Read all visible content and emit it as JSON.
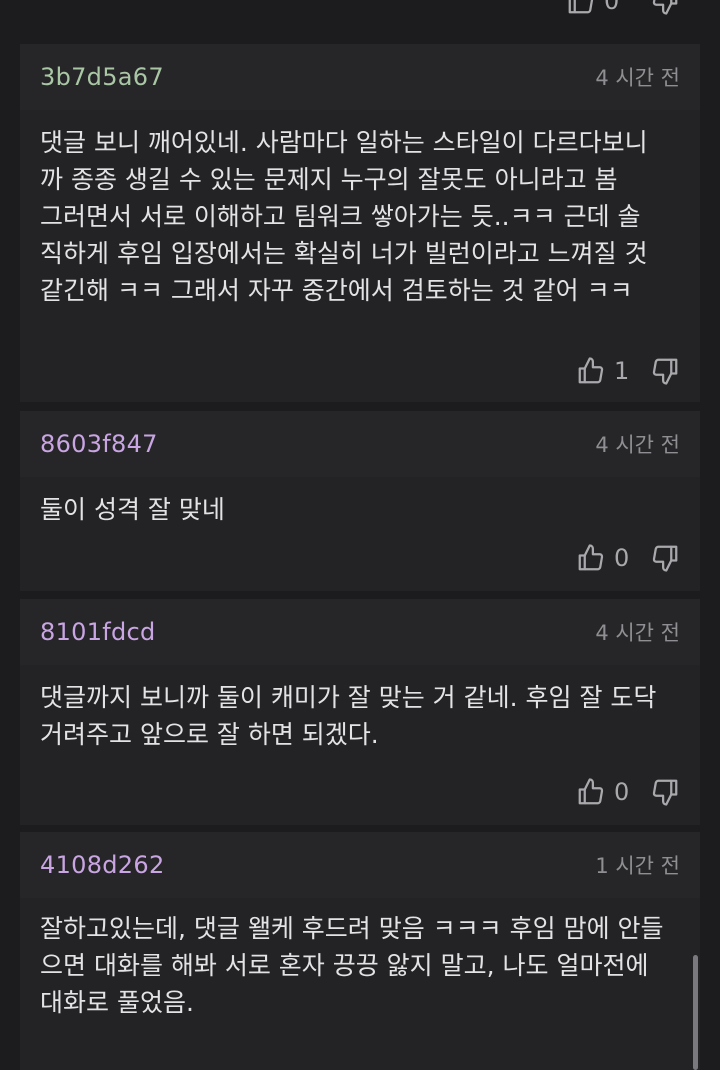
{
  "colors": {
    "background": "#1c1c1e",
    "card": "#232325",
    "text": "#e3e3e5",
    "muted": "#8f8f93"
  },
  "top": {
    "like_count": "0"
  },
  "comments": [
    {
      "author": "3b7d5a67",
      "author_color": "#a9c6a5",
      "time": "4 시간 전",
      "text": "댓글 보니 깨어있네. 사람마다 일하는 스타일이 다르다보니\n까 종종 생길 수 있는 문제지 누구의 잘못도 아니라고 봄\n그러면서 서로 이해하고 팀워크 쌓아가는 듯..ㅋㅋ 근데 솔\n직하게 후임 입장에서는 확실히 너가 빌런이라고 느껴질 것\n같긴해 ㅋㅋ 그래서 자꾸 중간에서 검토하는 것 같어 ㅋㅋ",
      "likes": "1"
    },
    {
      "author": "8603f847",
      "author_color": "#c9a5e3",
      "time": "4 시간 전",
      "text": "둘이 성격 잘 맞네",
      "likes": "0"
    },
    {
      "author": "8101fdcd",
      "author_color": "#c9a5e3",
      "time": "4 시간 전",
      "text": "댓글까지 보니까 둘이 캐미가 잘 맞는 거 같네. 후임 잘 도닥\n거려주고 앞으로 잘 하면 되겠다.",
      "likes": "0"
    },
    {
      "author": "4108d262",
      "author_color": "#c9a5e3",
      "time": "1 시간 전",
      "text": "잘하고있는데, 댓글 왤케 후드려 맞음 ㅋㅋㅋ 후임 맘에 안들\n으면 대화를 해봐 서로 혼자 끙끙 앓지 말고, 나도 얼마전에\n대화로 풀었음.",
      "likes": ""
    }
  ]
}
